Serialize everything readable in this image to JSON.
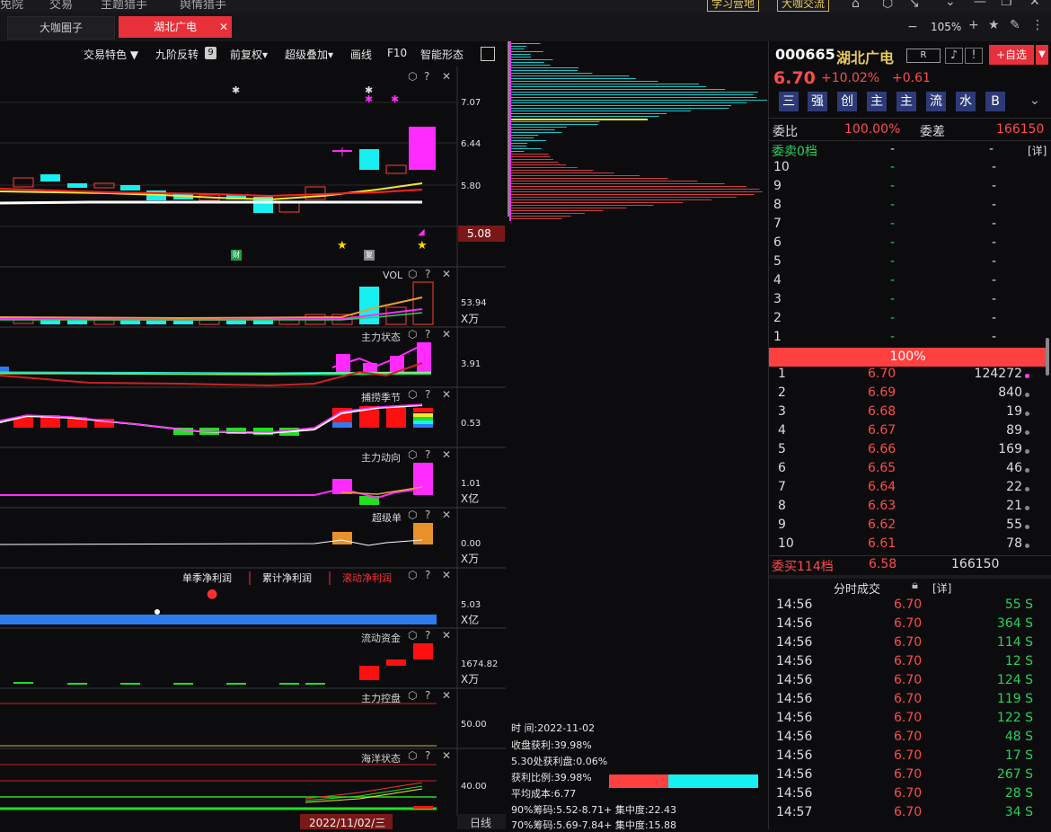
{
  "menu": {
    "items": [
      "免院",
      "交易",
      "主题猎手",
      "舆情猎手"
    ],
    "pills": [
      "学习营地",
      "大咖交流"
    ]
  },
  "tabs": [
    {
      "label": "大咖圈子"
    },
    {
      "label": "湖北广电"
    }
  ],
  "window": {
    "zoom": "105%"
  },
  "toolbar": {
    "items": [
      "交易特色 ▼",
      "九阶反转",
      "前复权▾",
      "超级叠加▾",
      "画线",
      "F10",
      "智能形态"
    ],
    "nine_badge": "9"
  },
  "main_chart": {
    "y_labels": [
      "7.07",
      "6.44",
      "5.80"
    ],
    "price_tag": "5.08",
    "badges": {
      "cai": "财",
      "fu": "复"
    }
  },
  "panels": [
    {
      "title": "VOL",
      "value": "53.94",
      "unit": "X万"
    },
    {
      "title": "主力状态",
      "value": "3.91",
      "unit": ""
    },
    {
      "title": "捕捞季节",
      "value": "0.53",
      "unit": ""
    },
    {
      "title": "主力动向",
      "value": "1.01",
      "unit": "X亿"
    },
    {
      "title": "超级单",
      "value": "0.00",
      "unit": "X万"
    },
    {
      "title": "",
      "value": "5.03",
      "unit": "X亿"
    },
    {
      "title": "流动资金",
      "value": "1674.82",
      "unit": "X万"
    },
    {
      "title": "主力控盘",
      "value": "50.00",
      "unit": ""
    },
    {
      "title": "海洋状态",
      "value": "40.00",
      "unit": ""
    }
  ],
  "profit_legend": [
    "单季净利润",
    "累计净利润",
    "滚动净利润"
  ],
  "date_bar": {
    "date": "2022/11/02/三",
    "period": "日线"
  },
  "chip": {
    "lines": [
      "时         间:2022-11-02",
      "收盘获利:39.98%",
      "5.30处获利盘:0.06%",
      "获利比例:39.98%",
      "平均成本:6.77",
      "90%筹码:5.52-8.71+ 集中度:22.43",
      "70%筹码:5.69-7.84+ 集中度:15.88"
    ],
    "profit_ratio": 0.3998
  },
  "stock": {
    "code": "000665",
    "name": "湖北广电",
    "badge": "R",
    "add_label": "+自选",
    "price": "6.70",
    "pct": "+10.02%",
    "change": "+0.61",
    "tags": [
      "三",
      "强",
      "创",
      "主",
      "主",
      "流",
      "水",
      "B"
    ]
  },
  "order_book": {
    "weibi_label": "委比",
    "weibi": "100.00%",
    "weicha_label": "委差",
    "weicha": "166150",
    "sell_header": "委卖0档",
    "detail": "[详]",
    "sell": [
      {
        "n": "10",
        "p": "-",
        "v": "-"
      },
      {
        "n": "9",
        "p": "-",
        "v": "-"
      },
      {
        "n": "8",
        "p": "-",
        "v": "-"
      },
      {
        "n": "7",
        "p": "-",
        "v": "-"
      },
      {
        "n": "6",
        "p": "-",
        "v": "-"
      },
      {
        "n": "5",
        "p": "-",
        "v": "-"
      },
      {
        "n": "4",
        "p": "-",
        "v": "-"
      },
      {
        "n": "3",
        "p": "-",
        "v": "-"
      },
      {
        "n": "2",
        "p": "-",
        "v": "-"
      },
      {
        "n": "1",
        "p": "-",
        "v": "-"
      }
    ],
    "ratio_bar": "100%",
    "buy": [
      {
        "n": "1",
        "p": "6.70",
        "v": "124272"
      },
      {
        "n": "2",
        "p": "6.69",
        "v": "840"
      },
      {
        "n": "3",
        "p": "6.68",
        "v": "19"
      },
      {
        "n": "4",
        "p": "6.67",
        "v": "89"
      },
      {
        "n": "5",
        "p": "6.66",
        "v": "169"
      },
      {
        "n": "6",
        "p": "6.65",
        "v": "46"
      },
      {
        "n": "7",
        "p": "6.64",
        "v": "22"
      },
      {
        "n": "8",
        "p": "6.63",
        "v": "21"
      },
      {
        "n": "9",
        "p": "6.62",
        "v": "55"
      },
      {
        "n": "10",
        "p": "6.61",
        "v": "78"
      }
    ],
    "buy_footer": {
      "label": "委买114档",
      "price": "6.58",
      "vol": "166150"
    }
  },
  "trades": {
    "title": "分时成交",
    "detail": "[详]",
    "rows": [
      {
        "t": "14:56",
        "p": "6.70",
        "v": "55",
        "s": "S"
      },
      {
        "t": "14:56",
        "p": "6.70",
        "v": "364",
        "s": "S"
      },
      {
        "t": "14:56",
        "p": "6.70",
        "v": "114",
        "s": "S"
      },
      {
        "t": "14:56",
        "p": "6.70",
        "v": "12",
        "s": "S"
      },
      {
        "t": "14:56",
        "p": "6.70",
        "v": "124",
        "s": "S"
      },
      {
        "t": "14:56",
        "p": "6.70",
        "v": "119",
        "s": "S"
      },
      {
        "t": "14:56",
        "p": "6.70",
        "v": "122",
        "s": "S"
      },
      {
        "t": "14:56",
        "p": "6.70",
        "v": "48",
        "s": "S"
      },
      {
        "t": "14:56",
        "p": "6.70",
        "v": "17",
        "s": "S"
      },
      {
        "t": "14:56",
        "p": "6.70",
        "v": "267",
        "s": "S"
      },
      {
        "t": "14:56",
        "p": "6.70",
        "v": "28",
        "s": "S"
      },
      {
        "t": "14:57",
        "p": "6.70",
        "v": "34",
        "s": "S"
      }
    ]
  },
  "colors": {
    "red": "#ff4b4b",
    "green": "#2bd15a",
    "cyan": "#17f0f0",
    "magenta": "#ff2bff",
    "yellow": "#f0e830",
    "blue": "#2e7bf0"
  }
}
